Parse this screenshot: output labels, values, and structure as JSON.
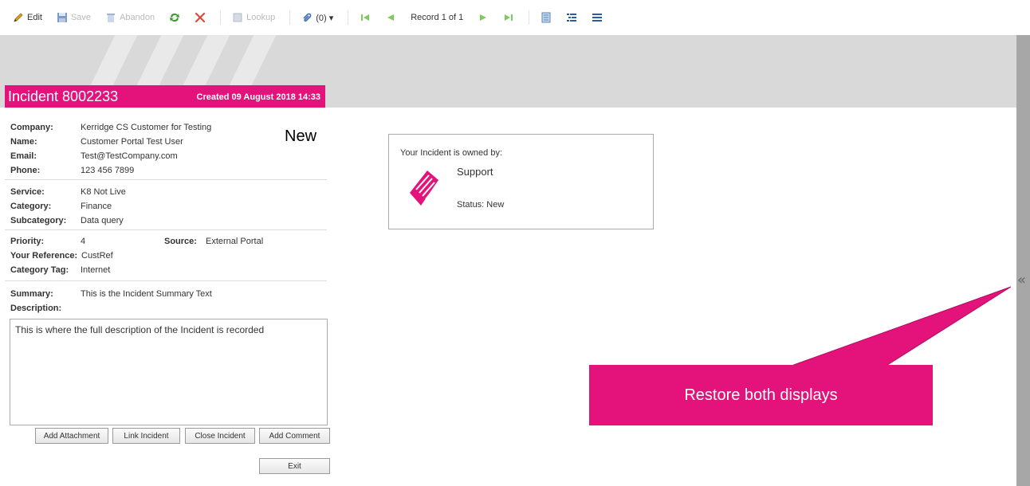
{
  "toolbar": {
    "edit": "Edit",
    "save": "Save",
    "abandon": "Abandon",
    "lookup": "Lookup",
    "attachments": "(0) ▾",
    "record": "Record 1 of 1"
  },
  "incident": {
    "title": "Incident 8002233",
    "created": "Created 09 August 2018 14:33",
    "status": "New",
    "company_label": "Company:",
    "company": "Kerridge CS Customer for Testing",
    "name_label": "Name:",
    "name": "Customer Portal Test User",
    "email_label": "Email:",
    "email": "Test@TestCompany.com",
    "phone_label": "Phone:",
    "phone": "123 456 7899",
    "service_label": "Service:",
    "service": "K8 Not Live",
    "category_label": "Category:",
    "category": "Finance",
    "subcategory_label": "Subcategory:",
    "subcategory": "Data query",
    "priority_label": "Priority:",
    "priority": "4",
    "source_label": "Source:",
    "source": "External Portal",
    "reference_label": "Your Reference:",
    "reference": "CustRef",
    "category_tag_label": "Category Tag:",
    "category_tag": "Internet",
    "summary_label": "Summary:",
    "summary": "This is the Incident Summary Text",
    "description_label": "Description:",
    "description": "This is where the full description of the Incident is recorded"
  },
  "buttons": {
    "add_attachment": "Add Attachment",
    "link_incident": "Link Incident",
    "close_incident": "Close Incident",
    "add_comment": "Add Comment",
    "exit": "Exit"
  },
  "owner": {
    "label": "Your Incident is owned by:",
    "name": "Support",
    "status": "Status: New"
  },
  "callout": {
    "text": "Restore both displays"
  },
  "sidebar": {
    "collapse": "«"
  },
  "colors": {
    "accent": "#e4137b",
    "banner": "#d9d9d9",
    "scrollbar": "#a7a7a7"
  }
}
